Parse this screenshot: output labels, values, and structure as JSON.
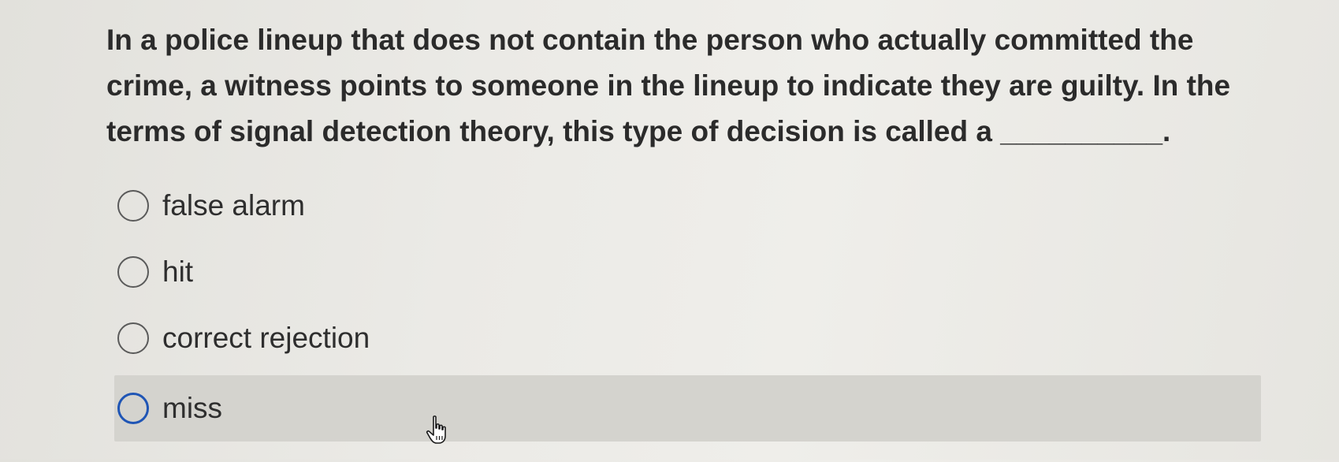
{
  "question": {
    "text": "In a police lineup that does not contain the person who actually committed the crime, a witness points to someone in the lineup to indicate they are guilty. In the terms of signal detection theory, this type of decision is called a __________."
  },
  "options": [
    {
      "label": "false alarm",
      "selected": false,
      "hovered": false
    },
    {
      "label": "hit",
      "selected": false,
      "hovered": false
    },
    {
      "label": "correct rejection",
      "selected": false,
      "hovered": false
    },
    {
      "label": "miss",
      "selected": false,
      "hovered": true
    }
  ],
  "cursor": {
    "icon": "hand-pointer-icon"
  },
  "colors": {
    "background": "#ebeae6",
    "hover_highlight": "#d4d3ce",
    "focus_ring": "#1f55b5",
    "text": "#2b2b2b"
  }
}
